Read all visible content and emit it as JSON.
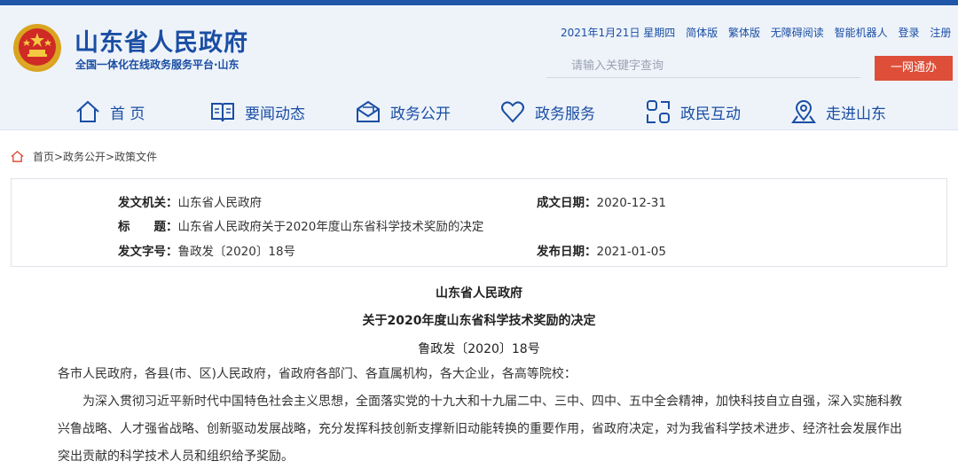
{
  "site": {
    "title": "山东省人民政府",
    "subtitle": "全国一体化在线政务服务平台·山东"
  },
  "util": {
    "date": "2021年1月21日 星期四",
    "links": [
      "简体版",
      "繁体版",
      "无障碍阅读",
      "智能机器人",
      "登录",
      "注册"
    ]
  },
  "search": {
    "placeholder": "请输入关键字查询",
    "button": "一网通办"
  },
  "nav": [
    {
      "label": "首 页",
      "icon": "home-icon"
    },
    {
      "label": "要闻动态",
      "icon": "book-icon"
    },
    {
      "label": "政务公开",
      "icon": "mail-icon"
    },
    {
      "label": "政务服务",
      "icon": "heart-icon"
    },
    {
      "label": "政民互动",
      "icon": "interact-icon"
    },
    {
      "label": "走进山东",
      "icon": "location-icon"
    }
  ],
  "breadcrumb": "首页>政务公开>政策文件",
  "meta": {
    "issuer_key": "发文机关：",
    "issuer": "山东省人民政府",
    "date_key": "成文日期：",
    "date": "2020-12-31",
    "title_key": "标　　题：",
    "title": "山东省人民政府关于2020年度山东省科学技术奖励的决定",
    "number_key": "发文字号：",
    "number": "鲁政发〔2020〕18号",
    "publish_key": "发布日期：",
    "publish": "2021-01-05"
  },
  "doc": {
    "org": "山东省人民政府",
    "title": "关于2020年度山东省科学技术奖励的决定",
    "number": "鲁政发〔2020〕18号",
    "salutation": "各市人民政府，各县(市、区)人民政府，省政府各部门、各直属机构，各大企业，各高等院校：",
    "body": "为深入贯彻习近平新时代中国特色社会主义思想，全面落实党的十九大和十九届二中、三中、四中、五中全会精神，加快科技自立自强，深入实施科教兴鲁战略、人才强省战略、创新驱动发展战略，充分发挥科技创新支撑新旧动能转换的重要作用，省政府决定，对为我省科学技术进步、经济社会发展作出突出贡献的科学技术人员和组织给予奖励。"
  },
  "colors": {
    "brand": "#1a4ea3",
    "accent": "#dd4f39"
  }
}
